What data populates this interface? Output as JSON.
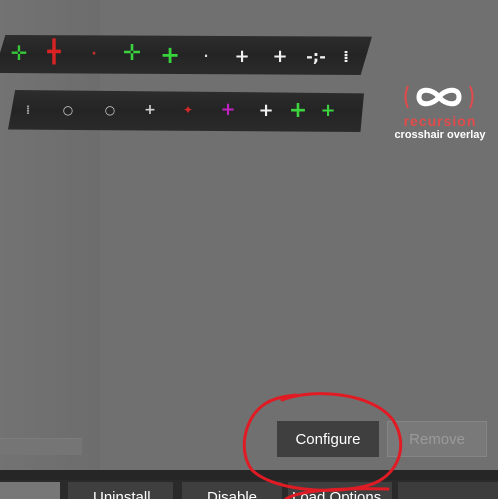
{
  "crosshair_banners": {
    "row1": [
      {
        "glyph": "✛",
        "color": "#35c93a"
      },
      {
        "glyph": "╋",
        "color": "#d92323"
      },
      {
        "glyph": "·",
        "color": "#c63030"
      },
      {
        "glyph": "✛",
        "color": "#3ad23f"
      },
      {
        "glyph": "+",
        "color": "#37d33c"
      },
      {
        "glyph": "·",
        "color": "#dcdcdc"
      },
      {
        "glyph": "+",
        "color": "#f0f0f0"
      },
      {
        "glyph": "+",
        "color": "#f0f0f0"
      },
      {
        "glyph": "-;-",
        "color": "#f0f0f0"
      },
      {
        "glyph": "⁞",
        "color": "#f0f0f0"
      }
    ],
    "row2": [
      {
        "glyph": "⁞",
        "color": "#9a9a9a"
      },
      {
        "glyph": "○",
        "color": "#cfcfcf"
      },
      {
        "glyph": "○",
        "color": "#cfcfcf"
      },
      {
        "glyph": "+",
        "color": "#cfcfcf"
      },
      {
        "glyph": "✦",
        "color": "#d62828"
      },
      {
        "glyph": "+",
        "color": "#c322c3"
      },
      {
        "glyph": "+",
        "color": "#f0f0f0"
      },
      {
        "glyph": "+",
        "color": "#3dd43f"
      },
      {
        "glyph": "+",
        "color": "#3dd43f"
      }
    ]
  },
  "logo": {
    "mark_icon": "infinity-icon",
    "wordmark": "recursion",
    "subtitle": "crosshair overlay",
    "accent": "#e34a4a"
  },
  "actions": {
    "configure_label": "Configure",
    "remove_label": "Remove"
  },
  "tabs": {
    "uninstall_label": "Uninstall",
    "disable_label": "Disable",
    "options_label": "Load Options"
  },
  "annotation": {
    "color": "#e01b24"
  }
}
